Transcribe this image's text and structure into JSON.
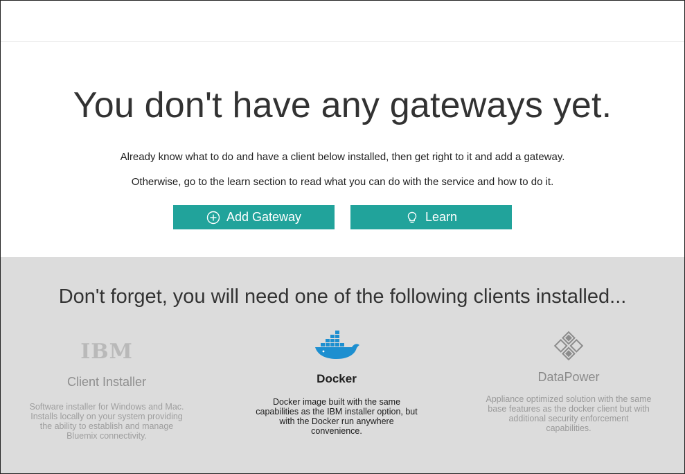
{
  "empty_state": {
    "heading": "You don't have any gateways yet.",
    "line1": "Already know what to do and have a client below installed, then get right to it and add a gateway.",
    "line2": "Otherwise, go to the learn section to read what you can do with the service and how to do it."
  },
  "buttons": {
    "add_gateway": {
      "label": "Add Gateway",
      "icon": "plus-circle-icon"
    },
    "learn": {
      "label": "Learn",
      "icon": "lightbulb-icon"
    }
  },
  "clients": {
    "heading": "Don't forget, you will need one of the following clients installed...",
    "items": [
      {
        "logo_text": "IBM",
        "name": "Client Installer",
        "description": "Software installer for Windows and Mac. Installs locally on your system providing the ability to establish and manage Bluemix connectivity."
      },
      {
        "logo": "docker-whale-icon",
        "name": "Docker",
        "description": "Docker image built with the same capabilities as the IBM installer option, but with the Docker run anywhere convenience."
      },
      {
        "logo": "datapower-diamond-icon",
        "name": "DataPower",
        "description": "Appliance optimized solution with the same base features as the docker client but with additional security enforcement capabilities."
      }
    ]
  },
  "colors": {
    "accent": "#21a39b",
    "clients_bg": "#dcdcdc",
    "docker_blue": "#1d8fd0"
  }
}
